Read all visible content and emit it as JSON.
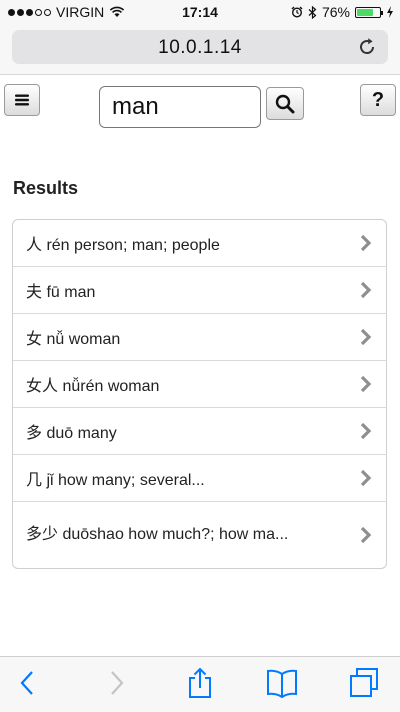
{
  "status_bar": {
    "carrier": "VIRGIN",
    "time": "17:14",
    "battery_percent": "76%",
    "battery_level": 0.76,
    "signal_bars_filled": 3,
    "signal_bars_total": 5
  },
  "browser": {
    "url": "10.0.1.14"
  },
  "search": {
    "value": "man",
    "help_label": "?"
  },
  "results": {
    "title": "Results",
    "items": [
      {
        "text": "人 rén person; man; people"
      },
      {
        "text": "夫 fū man"
      },
      {
        "text": "女 nǚ woman"
      },
      {
        "text": "女人 nǚrén woman"
      },
      {
        "text": "多 duō many"
      },
      {
        "text": "几 jǐ how many; several..."
      },
      {
        "text": "多少 duōshao how much?; how ma..."
      }
    ]
  },
  "colors": {
    "accent": "#007aff",
    "battery": "#4cd964",
    "chevron": "#8e8e8e"
  }
}
